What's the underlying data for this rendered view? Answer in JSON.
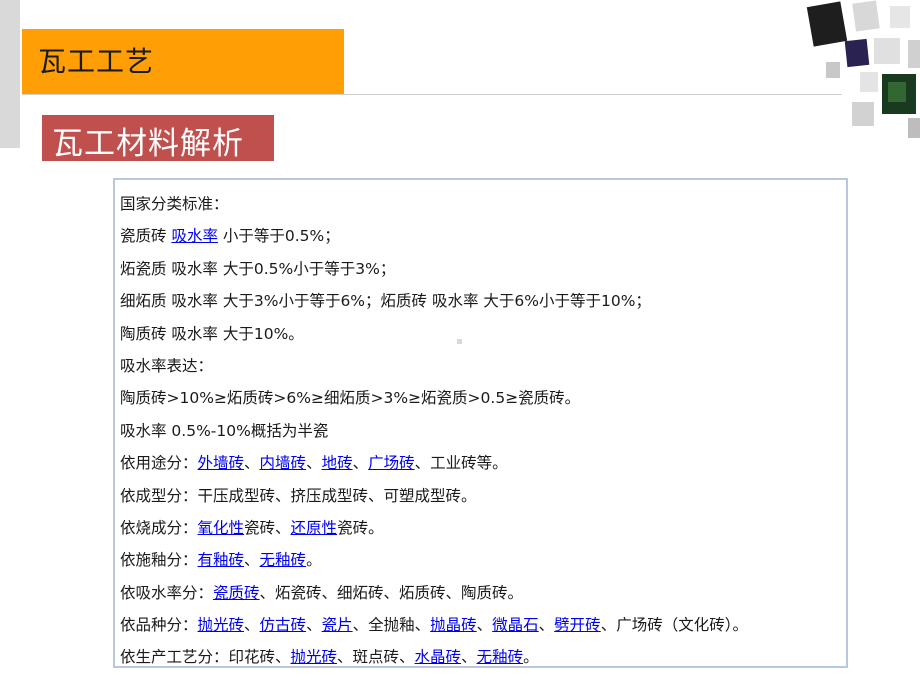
{
  "slide": {
    "title": "瓦工工艺",
    "subtitle": "瓦工材料解析"
  },
  "content": {
    "lines": [
      [
        {
          "text": "国家分类标准："
        }
      ],
      [
        {
          "text": "瓷质砖 "
        },
        {
          "text": "吸水率",
          "link": true
        },
        {
          "text": " 小于等于0.5%；"
        }
      ],
      [
        {
          "text": "炻瓷质 吸水率 大于0.5%小于等于3%；"
        }
      ],
      [
        {
          "text": "细炻质 吸水率 大于3%小于等于6%；炻质砖 吸水率 大于6%小于等于10%；"
        }
      ],
      [
        {
          "text": "陶质砖 吸水率 大于10%。"
        }
      ],
      [
        {
          "text": "吸水率表达："
        }
      ],
      [
        {
          "text": "陶质砖>10%≥炻质砖>6%≥细炻质>3%≥炻瓷质>0.5≥瓷质砖。"
        }
      ],
      [
        {
          "text": "吸水率 0.5%-10%概括为半瓷"
        }
      ],
      [
        {
          "text": "依用途分："
        },
        {
          "text": "外墙砖",
          "link": true
        },
        {
          "text": "、"
        },
        {
          "text": "内墙砖",
          "link": true
        },
        {
          "text": "、"
        },
        {
          "text": "地砖",
          "link": true
        },
        {
          "text": "、"
        },
        {
          "text": "广场砖",
          "link": true
        },
        {
          "text": "、工业砖等。"
        }
      ],
      [
        {
          "text": "依成型分：干压成型砖、挤压成型砖、可塑成型砖。"
        }
      ],
      [
        {
          "text": "依烧成分："
        },
        {
          "text": "氧化性",
          "link": true
        },
        {
          "text": "瓷砖、"
        },
        {
          "text": "还原性",
          "link": true
        },
        {
          "text": "瓷砖。"
        }
      ],
      [
        {
          "text": "依施釉分："
        },
        {
          "text": "有釉砖",
          "link": true
        },
        {
          "text": "、"
        },
        {
          "text": "无釉砖",
          "link": true
        },
        {
          "text": "。"
        }
      ],
      [
        {
          "text": "依吸水率分："
        },
        {
          "text": "瓷质砖",
          "link": true
        },
        {
          "text": "、炻瓷砖、细炻砖、炻质砖、陶质砖。"
        }
      ],
      [
        {
          "text": "依品种分："
        },
        {
          "text": "抛光砖",
          "link": true
        },
        {
          "text": "、"
        },
        {
          "text": "仿古砖",
          "link": true
        },
        {
          "text": "、"
        },
        {
          "text": "瓷片",
          "link": true
        },
        {
          "text": "、全抛釉、"
        },
        {
          "text": "抛晶砖",
          "link": true
        },
        {
          "text": "、"
        },
        {
          "text": "微晶石",
          "link": true
        },
        {
          "text": "、"
        },
        {
          "text": "劈开砖",
          "link": true
        },
        {
          "text": "、广场砖（文化砖）。"
        }
      ],
      [
        {
          "text": "依生产工艺分：印花砖、"
        },
        {
          "text": "抛光砖",
          "link": true
        },
        {
          "text": "、斑点砖、"
        },
        {
          "text": "水晶砖",
          "link": true
        },
        {
          "text": "、"
        },
        {
          "text": "无釉砖",
          "link": true
        },
        {
          "text": "。"
        }
      ]
    ]
  },
  "colors": {
    "title_bar": "#ff9f05",
    "subtitle_box": "#c0504d",
    "link": "#0000ee",
    "box_border": "#b8c7de"
  }
}
